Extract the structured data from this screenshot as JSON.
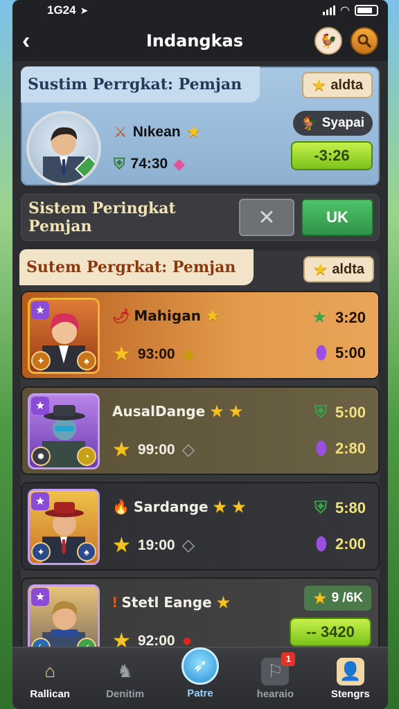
{
  "status_bar": {
    "time": "1G24"
  },
  "header": {
    "title": "Indangkas"
  },
  "featured_card": {
    "title": "Sustim Perrgkat: Pemjan",
    "chip_label": "aldta",
    "player_name": "Nıkean",
    "score": "74:30",
    "side_chip_label": "Syapai",
    "action_value": "-3:26"
  },
  "confirm_bar": {
    "title": "Sistem Peringkat Pemjan",
    "cancel_symbol": "✕",
    "ok_label": "UK"
  },
  "leaderboard": {
    "title": "Sutem Pergrkat: Pemjan",
    "chip_label": "aldta",
    "players": [
      {
        "name": "Mahigan",
        "score": "93:00",
        "stat_top": "3:20",
        "stat_bottom": "5:00"
      },
      {
        "name": "AusalDange",
        "score": "99:00",
        "stat_top": "5:00",
        "stat_bottom": "2:80"
      },
      {
        "name": "Sardange",
        "score": "19:00",
        "stat_top": "5:80",
        "stat_bottom": "2:00"
      },
      {
        "name": "Stetl Eange",
        "score": "92:00",
        "stat_top": "9 /6K",
        "stat_bottom": "-- 3420"
      }
    ]
  },
  "bottom_nav": {
    "items": [
      {
        "label": "Rallican"
      },
      {
        "label": "Denitim"
      },
      {
        "label": "Patre"
      },
      {
        "label": "hearaio",
        "badge": "1"
      },
      {
        "label": "Stengrs"
      }
    ]
  }
}
